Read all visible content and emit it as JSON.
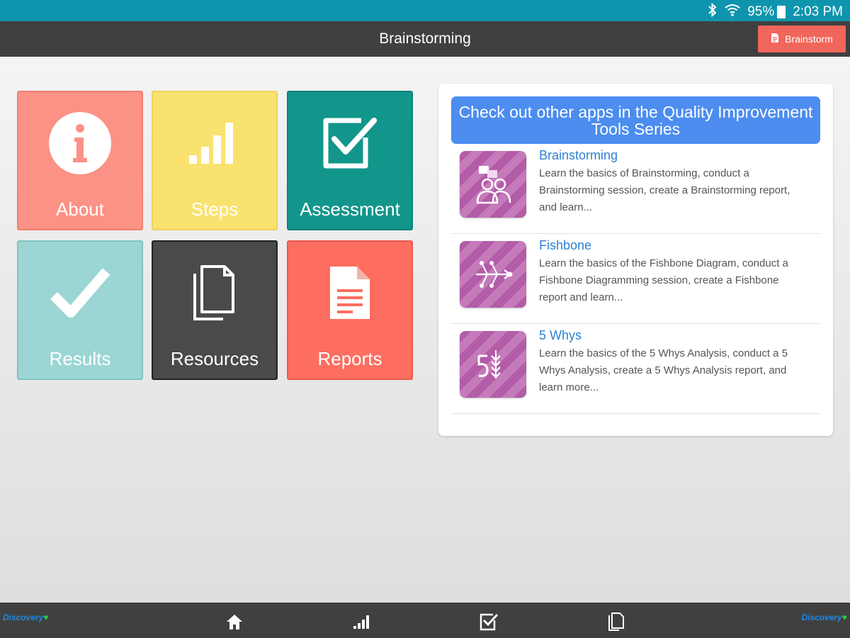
{
  "status_bar": {
    "battery": "95%",
    "time": "2:03 PM"
  },
  "app_bar": {
    "title": "Brainstorming",
    "action_label": "Brainstorm"
  },
  "tiles": [
    {
      "label": "About",
      "icon": "info-icon",
      "color": "#fc9185"
    },
    {
      "label": "Steps",
      "icon": "steps-bars-icon",
      "color": "#f9e26f"
    },
    {
      "label": "Assessment",
      "icon": "checkbox-icon",
      "color": "#12968b"
    },
    {
      "label": "Results",
      "icon": "checkmark-icon",
      "color": "#9bd6d4"
    },
    {
      "label": "Resources",
      "icon": "documents-icon",
      "color": "#4a4a4a"
    },
    {
      "label": "Reports",
      "icon": "report-document-icon",
      "color": "#fd6e60"
    }
  ],
  "promo": {
    "header": "Check out other apps in the Quality Improvement Tools Series",
    "apps": [
      {
        "name": "Brainstorming",
        "description": "Learn the basics of Brainstorming, conduct a Brainstorming session, create a Brainstorming report, and learn..."
      },
      {
        "name": "Fishbone",
        "description": "Learn the basics of the Fishbone Diagram, conduct a Fishbone Diagramming session, create a Fishbone report and learn..."
      },
      {
        "name": "5 Whys",
        "description": "Learn the basics of the 5 Whys Analysis, conduct a 5 Whys Analysis, create a 5 Whys Analysis report, and learn more..."
      }
    ]
  },
  "bottom_bar": {
    "brand_left": "Discovery",
    "brand_right": "Discovery",
    "nav": [
      "home-icon",
      "steps-bars-icon",
      "checkbox-icon",
      "documents-icon"
    ]
  },
  "colors": {
    "status_bar": "#0e95ad",
    "app_bar": "#404040",
    "action": "#f0665a",
    "promo_header": "#4c8def",
    "link": "#2e7fd4"
  }
}
